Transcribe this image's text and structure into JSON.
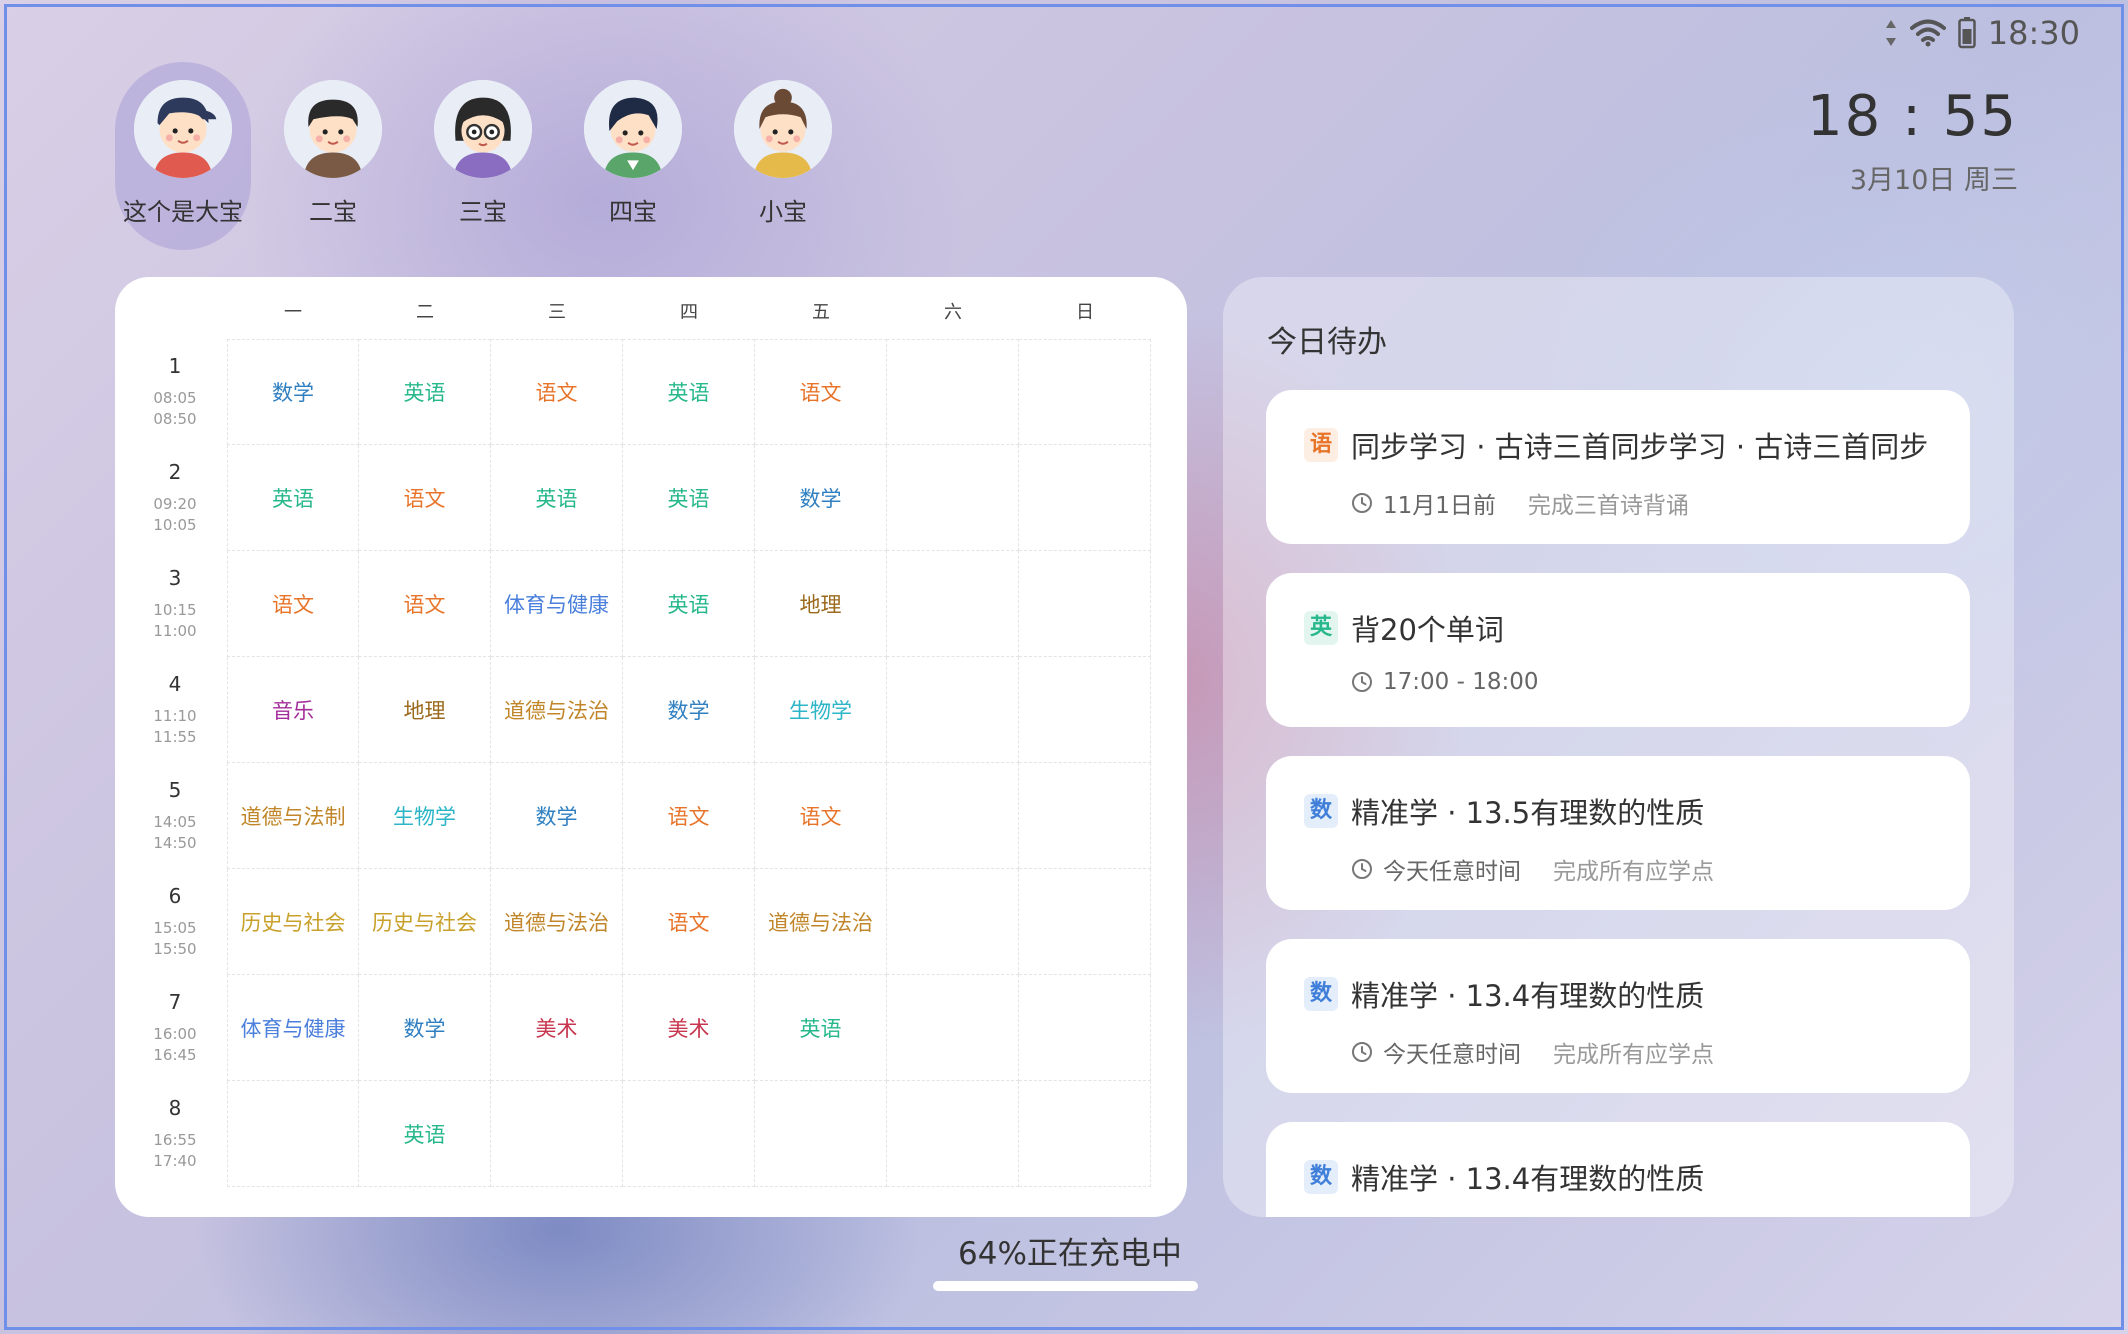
{
  "status_bar": {
    "time": "18:30",
    "icons": [
      "data-arrows-icon",
      "wifi-icon",
      "battery-icon"
    ]
  },
  "clock": {
    "time": "18 : 55",
    "date": "3月10日 周三"
  },
  "profiles": [
    {
      "name": "这个是大宝",
      "active": true
    },
    {
      "name": "二宝",
      "active": false
    },
    {
      "name": "三宝",
      "active": false
    },
    {
      "name": "四宝",
      "active": false
    },
    {
      "name": "小宝",
      "active": false
    }
  ],
  "timetable": {
    "days": [
      "一",
      "二",
      "三",
      "四",
      "五",
      "六",
      "日"
    ],
    "periods": [
      {
        "num": "1",
        "start": "08:05",
        "end": "08:50"
      },
      {
        "num": "2",
        "start": "09:20",
        "end": "10:05"
      },
      {
        "num": "3",
        "start": "10:15",
        "end": "11:00"
      },
      {
        "num": "4",
        "start": "11:10",
        "end": "11:55"
      },
      {
        "num": "5",
        "start": "14:05",
        "end": "14:50"
      },
      {
        "num": "6",
        "start": "15:05",
        "end": "15:50"
      },
      {
        "num": "7",
        "start": "16:00",
        "end": "16:45"
      },
      {
        "num": "8",
        "start": "16:55",
        "end": "17:40"
      }
    ],
    "rows": [
      [
        "数学",
        "英语",
        "语文",
        "英语",
        "语文",
        "",
        ""
      ],
      [
        "英语",
        "语文",
        "英语",
        "英语",
        "数学",
        "",
        ""
      ],
      [
        "语文",
        "语文",
        "体育与健康",
        "英语",
        "地理",
        "",
        ""
      ],
      [
        "音乐",
        "地理",
        "道德与法治",
        "数学",
        "生物学",
        "",
        ""
      ],
      [
        "道德与法制",
        "生物学",
        "数学",
        "语文",
        "语文",
        "",
        ""
      ],
      [
        "历史与社会",
        "历史与社会",
        "道德与法治",
        "语文",
        "道德与法治",
        "",
        ""
      ],
      [
        "体育与健康",
        "数学",
        "美术",
        "美术",
        "英语",
        "",
        ""
      ],
      [
        "",
        "英语",
        "",
        "",
        "",
        "",
        ""
      ]
    ],
    "subject_colors": {
      "数学": "#2f7fc1",
      "英语": "#26b78a",
      "语文": "#e8742a",
      "体育与健康": "#4a7fdc",
      "地理": "#9b6a1c",
      "音乐": "#a32c9a",
      "道德与法治": "#c1862a",
      "道德与法制": "#c1862a",
      "生物学": "#2bb5c7",
      "历史与社会": "#c8a02a",
      "美术": "#c8364f"
    }
  },
  "todo": {
    "title": "今日待办",
    "items": [
      {
        "badge": "语",
        "badge_color": "#e8742a",
        "badge_bg": "#fdeee3",
        "title": "同步学习 · 古诗三首同步学习 · 古诗三首同步",
        "time": "11月1日前",
        "note": "完成三首诗背诵"
      },
      {
        "badge": "英",
        "badge_color": "#26b78a",
        "badge_bg": "#e2f6ef",
        "title": "背20个单词",
        "time": "17:00 - 18:00",
        "note": ""
      },
      {
        "badge": "数",
        "badge_color": "#3f7fd9",
        "badge_bg": "#e4eefb",
        "title": "精准学 · 13.5有理数的性质",
        "time": "今天任意时间",
        "note": "完成所有应学点"
      },
      {
        "badge": "数",
        "badge_color": "#3f7fd9",
        "badge_bg": "#e4eefb",
        "title": "精准学 · 13.4有理数的性质",
        "time": "今天任意时间",
        "note": "完成所有应学点"
      },
      {
        "badge": "数",
        "badge_color": "#3f7fd9",
        "badge_bg": "#e4eefb",
        "title": "精准学 · 13.4有理数的性质",
        "time": "",
        "note": ""
      }
    ]
  },
  "charging": "64%正在充电中"
}
